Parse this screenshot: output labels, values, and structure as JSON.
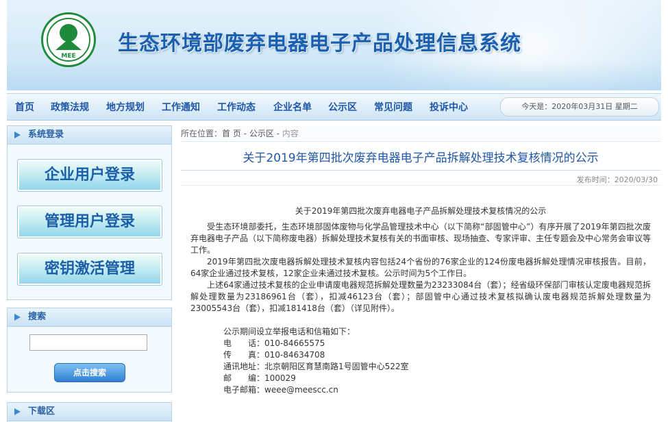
{
  "header": {
    "site_title": "生态环境部废弃电器电子产品处理信息系统",
    "logo_text": "MEE"
  },
  "nav": {
    "items": [
      "首页",
      "政策法规",
      "地方规划",
      "工作通知",
      "工作动态",
      "企业名单",
      "公示区",
      "常见问题",
      "投诉中心"
    ],
    "date": "今天是：2020年03月31日 星期二"
  },
  "sidebar": {
    "login_title": "系统登录",
    "buttons": [
      "企业用户登录",
      "管理用户登录",
      "密钥激活管理"
    ],
    "search_title": "搜索",
    "search_placeholder": "",
    "search_button": "点击搜索",
    "download_title": "下载区"
  },
  "breadcrumb": {
    "prefix": "所在位置：",
    "home": "首 页",
    "sep1": " - ",
    "section": "公示区",
    "sep2": " - ",
    "current": "内容"
  },
  "article": {
    "title": "关于2019年第四批次废弃电器电子产品拆解处理技术复核情况的公示",
    "publish_time": "发布时间：2020/03/30",
    "heading": "关于2019年第四批次废弃电器电子产品拆解处理技术复核情况的公示",
    "paragraphs": [
      "受生态环境部委托，生态环境部固体废物与化学品管理技术中心（以下简称“部固管中心”）有序开展了2019年第四批次废弃电器电子产品（以下简称废电器）拆解处理技术复核有关的书面审核、现场抽查、专家评审、主任专题会及中心常务会审议等工作。",
      "2019年第四批次废电器拆解处理技术复核内容包括24个省份的76家企业的124份废电器拆解处理情况审核报告。目前，64家企业通过技术复核，12家企业未通过技术复核。公示时间为5个工作日。",
      "上述64家通过技术复核的企业申请废电器规范拆解处理数量为23233084台（套）；经省级环保部门审核认定废电器规范拆解处理数量为23186961台（套），扣减46123台（套）；部固管中心通过技术复核拟确认废电器规范拆解处理数量为23005543台（套），扣减181418台（套）（详见附件）。"
    ],
    "contact_intro": "公示期间设立举报电话和信箱如下：",
    "contacts": [
      "电　　话：010-84665575",
      "传　　真：010-84634708",
      "通讯地址：北京朝阳区育慧南路1号固管中心522室",
      "邮　　编：100029",
      "电子邮箱：weee@meescc.cn"
    ]
  }
}
